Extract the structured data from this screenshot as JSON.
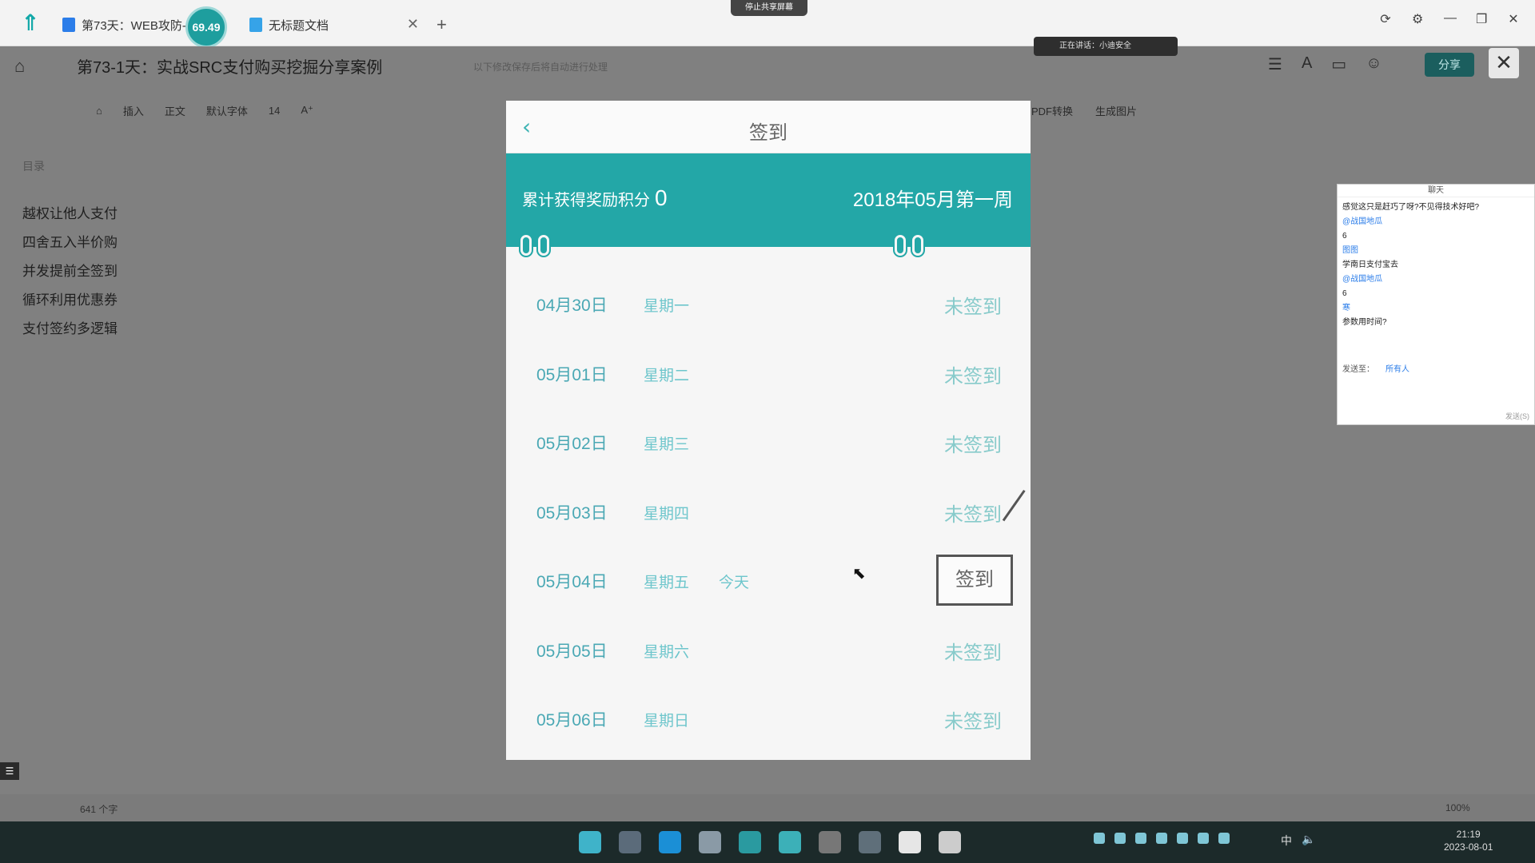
{
  "window": {
    "tabs": [
      {
        "label": "第73天：WEB攻防-3"
      },
      {
        "label": "无标题文档"
      }
    ],
    "timer_badge": "69.49",
    "share_pill": "停止共享屏幕",
    "controls": [
      "⟳",
      "⚙",
      "—",
      "❐",
      "✕"
    ]
  },
  "doc": {
    "title": "第73-1天：实战SRC支付购买挖掘分享案例",
    "subtitle": "以下修改保存后将自动进行处理",
    "speaker": "正在讲话：小迪安全",
    "share_button": "分享",
    "toolbar_left": [
      "插入",
      "正文",
      "默认字体",
      "14",
      "A⁺"
    ],
    "toolbar_right": [
      "PDF转换",
      "生成图片"
    ]
  },
  "toc": {
    "heading": "目录",
    "items": [
      {
        "label": "越权让他人支付"
      },
      {
        "label": "四舍五入半价购"
      },
      {
        "label": "并发提前全签到"
      },
      {
        "label": "循环利用优惠券"
      },
      {
        "label": "支付签约多逻辑"
      }
    ]
  },
  "signin": {
    "title": "签到",
    "points_label": "累计获得奖励积分",
    "points_value": "0",
    "week_label": "2018年05月第一周",
    "days": [
      {
        "date": "04月30日",
        "weekday": "星期一",
        "today": "",
        "status": "未签到"
      },
      {
        "date": "05月01日",
        "weekday": "星期二",
        "today": "",
        "status": "未签到"
      },
      {
        "date": "05月02日",
        "weekday": "星期三",
        "today": "",
        "status": "未签到"
      },
      {
        "date": "05月03日",
        "weekday": "星期四",
        "today": "",
        "status": "未签到"
      },
      {
        "date": "05月04日",
        "weekday": "星期五",
        "today": "今天",
        "status": "签到"
      },
      {
        "date": "05月05日",
        "weekday": "星期六",
        "today": "",
        "status": "未签到"
      },
      {
        "date": "05月06日",
        "weekday": "星期日",
        "today": "",
        "status": "未签到"
      }
    ]
  },
  "chat": {
    "title": "聊天",
    "lines": [
      {
        "text": "感觉这只是赶巧了呀?不见得技术好吧?",
        "kind": "msg"
      },
      {
        "text": "@战国地瓜",
        "kind": "name"
      },
      {
        "text": "6",
        "kind": "msg"
      },
      {
        "text": "图图",
        "kind": "name"
      },
      {
        "text": "学南日支付宝去",
        "kind": "msg"
      },
      {
        "text": "@战国地瓜",
        "kind": "name"
      },
      {
        "text": "6",
        "kind": "msg"
      },
      {
        "text": "寒",
        "kind": "name"
      },
      {
        "text": "参数用时间?",
        "kind": "msg"
      }
    ],
    "send_to_label": "发送至：",
    "send_to_value": "所有人",
    "send_hint": "发送(S)"
  },
  "status": {
    "word_count": "641 个字",
    "zoom": "100%"
  },
  "taskbar": {
    "icon_colors": [
      "#3fb3c9",
      "#5b6b7a",
      "#1b8fd6",
      "#8a9aa6",
      "#2a9aa0",
      "#3cb0b8",
      "#777777",
      "#5f6f7a",
      "#e6e6e6",
      "#cccccc"
    ],
    "time": "21:19",
    "date": "2023-08-01",
    "ime": "中"
  },
  "colors": {
    "accent": "#23a7a7",
    "status_text": "#88cbcb",
    "date_text": "#4aa8b4"
  }
}
